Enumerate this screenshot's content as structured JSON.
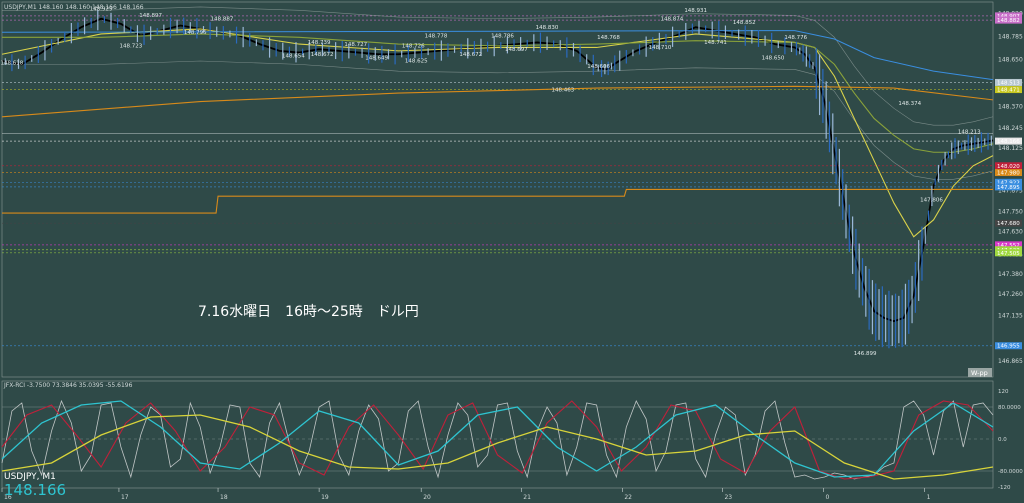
{
  "header": {
    "symbol_info": "USDJPY,M1  148.160 148.160 148.166 148.166",
    "osc_info": "JFX-RCI -3.7500 73.3846 35.0395 -55.6196",
    "annotation": "7.16水曜日　16時～25時　ドル円",
    "symbol_label": "USDJPY, M1",
    "current_price": "148.166",
    "pivot_tag": "W-pp"
  },
  "colors": {
    "background": "#2f4a48",
    "price_line": "#000000",
    "ma_fast": "#d9d24a",
    "ma_mid": "#8aa23a",
    "ma_slow": "#d88a1a",
    "band": "#9aa6a4",
    "resistance_blue": "#3a8ee0",
    "rci_short": "#c0c6c6",
    "rci_mid": "#c0203a",
    "rci_long_cyan": "#2ec4d0",
    "rci_long_yellow": "#d8d43a"
  },
  "chart_data": [
    {
      "type": "line",
      "name": "main",
      "ylim": [
        146.77,
        148.93
      ],
      "xlim": [
        0,
        1000
      ],
      "x_ticks": [
        {
          "x": 0,
          "label": "16"
        },
        {
          "x": 118,
          "label": "17"
        },
        {
          "x": 218,
          "label": "18"
        },
        {
          "x": 320,
          "label": "19"
        },
        {
          "x": 423,
          "label": "20"
        },
        {
          "x": 524,
          "label": "21"
        },
        {
          "x": 626,
          "label": "22"
        },
        {
          "x": 727,
          "label": "23"
        },
        {
          "x": 829,
          "label": "0"
        },
        {
          "x": 931,
          "label": "1"
        }
      ],
      "y_ticks": [
        "148.920",
        "148.785",
        "148.650",
        "148.515",
        "148.370",
        "148.245",
        "148.125",
        "147.875",
        "147.750",
        "147.630",
        "147.495",
        "147.380",
        "147.260",
        "147.135",
        "146.865"
      ],
      "price_tags": [
        {
          "value": 148.907,
          "label": "148.907",
          "color": "#c86ec8"
        },
        {
          "value": 148.882,
          "label": "148.882",
          "color": "#c86ec8"
        },
        {
          "value": 148.513,
          "label": "148.513",
          "color": "#b8c8d0"
        },
        {
          "value": 148.471,
          "label": "148.471",
          "color": "#c8c820"
        },
        {
          "value": 148.166,
          "label": "148.166",
          "color": "#e8e8e8"
        },
        {
          "value": 148.02,
          "label": "148.020",
          "color": "#c0203a"
        },
        {
          "value": 147.98,
          "label": "147.980",
          "color": "#d88a1a"
        },
        {
          "value": 147.922,
          "label": "147.922",
          "color": "#3a8ee0"
        },
        {
          "value": 147.895,
          "label": "147.895",
          "color": "#3a8ee0"
        },
        {
          "value": 147.68,
          "label": "147.680",
          "color": "#444444"
        },
        {
          "value": 147.552,
          "label": "147.552",
          "color": "#d838c8"
        },
        {
          "value": 147.523,
          "label": "147.523",
          "color": "#a0d840"
        },
        {
          "value": 147.505,
          "label": "147.505",
          "color": "#a0d840"
        },
        {
          "value": 146.955,
          "label": "146.955",
          "color": "#3a8ee0"
        }
      ],
      "price_labels": [
        {
          "x": 10,
          "v": 148.62,
          "text": "148.618"
        },
        {
          "x": 100,
          "v": 148.94,
          "text": "148.929"
        },
        {
          "x": 130,
          "v": 148.72,
          "text": "148.723"
        },
        {
          "x": 150,
          "v": 148.9,
          "text": "148.897"
        },
        {
          "x": 195,
          "v": 148.8,
          "text": "148.795"
        },
        {
          "x": 222,
          "v": 148.88,
          "text": "148.887"
        },
        {
          "x": 294,
          "v": 148.66,
          "text": "148.654"
        },
        {
          "x": 320,
          "v": 148.74,
          "text": "148.739"
        },
        {
          "x": 323,
          "v": 148.67,
          "text": "148.672"
        },
        {
          "x": 357,
          "v": 148.73,
          "text": "148.727"
        },
        {
          "x": 378,
          "v": 148.65,
          "text": "148.649"
        },
        {
          "x": 415,
          "v": 148.72,
          "text": "148.726"
        },
        {
          "x": 418,
          "v": 148.63,
          "text": "148.625"
        },
        {
          "x": 438,
          "v": 148.78,
          "text": "148.778"
        },
        {
          "x": 473,
          "v": 148.67,
          "text": "148.672"
        },
        {
          "x": 505,
          "v": 148.78,
          "text": "148.786"
        },
        {
          "x": 519,
          "v": 148.7,
          "text": "148.697"
        },
        {
          "x": 550,
          "v": 148.83,
          "text": "148.830"
        },
        {
          "x": 566,
          "v": 148.46,
          "text": "148.463"
        },
        {
          "x": 612,
          "v": 148.77,
          "text": "148.768"
        },
        {
          "x": 602,
          "v": 148.6,
          "text": "148.606"
        },
        {
          "x": 664,
          "v": 148.71,
          "text": "148.710"
        },
        {
          "x": 676,
          "v": 148.88,
          "text": "148.874"
        },
        {
          "x": 700,
          "v": 148.93,
          "text": "148.931"
        },
        {
          "x": 720,
          "v": 148.74,
          "text": "148.741"
        },
        {
          "x": 749,
          "v": 148.86,
          "text": "148.852"
        },
        {
          "x": 778,
          "v": 148.65,
          "text": "148.650"
        },
        {
          "x": 801,
          "v": 148.77,
          "text": "148.776"
        },
        {
          "x": 916,
          "v": 148.38,
          "text": "148.374"
        },
        {
          "x": 976,
          "v": 148.21,
          "text": "148.213"
        },
        {
          "x": 938,
          "v": 147.81,
          "text": "147.806"
        },
        {
          "x": 871,
          "v": 146.9,
          "text": "146.899"
        }
      ],
      "series": [
        {
          "role": "price",
          "x": [
            0,
            20,
            40,
            60,
            80,
            100,
            120,
            140,
            160,
            180,
            200,
            220,
            240,
            260,
            280,
            300,
            320,
            340,
            360,
            380,
            400,
            420,
            440,
            460,
            480,
            500,
            520,
            540,
            560,
            580,
            600,
            610,
            620,
            640,
            660,
            680,
            700,
            720,
            740,
            760,
            780,
            800,
            810,
            820,
            830,
            840,
            850,
            860,
            870,
            880,
            890,
            900,
            910,
            920,
            930,
            940,
            950,
            960,
            970,
            980,
            990,
            1000
          ],
          "values": [
            148.64,
            148.62,
            148.69,
            148.77,
            148.84,
            148.89,
            148.86,
            148.79,
            148.82,
            148.85,
            148.83,
            148.81,
            148.79,
            148.74,
            148.7,
            148.69,
            148.71,
            148.7,
            148.69,
            148.68,
            148.68,
            148.69,
            148.7,
            148.71,
            148.72,
            148.73,
            148.74,
            148.75,
            148.74,
            148.7,
            148.6,
            148.59,
            148.63,
            148.7,
            148.75,
            148.79,
            148.84,
            148.82,
            148.8,
            148.78,
            148.74,
            148.72,
            148.68,
            148.6,
            148.4,
            148.1,
            147.8,
            147.5,
            147.3,
            147.16,
            147.12,
            147.1,
            147.12,
            147.25,
            147.55,
            147.9,
            148.05,
            148.12,
            148.14,
            148.15,
            148.16,
            148.17
          ]
        },
        {
          "role": "ma_fast",
          "x": [
            0,
            100,
            200,
            300,
            400,
            500,
            600,
            700,
            800,
            820,
            840,
            860,
            880,
            900,
            920,
            940,
            960,
            980,
            1000
          ],
          "values": [
            148.68,
            148.8,
            148.83,
            148.74,
            148.7,
            148.72,
            148.72,
            148.8,
            148.75,
            148.72,
            148.55,
            148.3,
            148.05,
            147.8,
            147.6,
            147.7,
            147.9,
            148.02,
            148.08
          ]
        },
        {
          "role": "ma_mid",
          "x": [
            0,
            100,
            200,
            300,
            400,
            500,
            600,
            700,
            800,
            820,
            840,
            860,
            880,
            900,
            920,
            940,
            960,
            980,
            1000
          ],
          "values": [
            148.78,
            148.78,
            148.8,
            148.78,
            148.74,
            148.73,
            148.74,
            148.76,
            148.75,
            148.72,
            148.62,
            148.45,
            148.3,
            148.2,
            148.12,
            148.1,
            148.1,
            148.12,
            148.15
          ]
        },
        {
          "role": "ma_slow_stepped",
          "x": [
            0,
            216,
            218,
            628,
            630,
            1000
          ],
          "values": [
            147.74,
            147.74,
            147.84,
            147.84,
            147.88,
            147.88
          ]
        },
        {
          "role": "ma_slow_curve",
          "x": [
            0,
            200,
            400,
            600,
            800,
            900,
            1000
          ],
          "values": [
            148.31,
            148.4,
            148.45,
            148.48,
            148.49,
            148.48,
            148.41
          ]
        },
        {
          "role": "resistance",
          "x": [
            0,
            800,
            840,
            880,
            940,
            1000
          ],
          "values": [
            148.81,
            148.82,
            148.77,
            148.66,
            148.58,
            148.53
          ]
        }
      ]
    },
    {
      "type": "line",
      "name": "rci",
      "ylim": [
        -120,
        120
      ],
      "y_ticks": [
        "120",
        "80.0000",
        "0.0",
        "-80.0000",
        "-120"
      ],
      "series": [
        {
          "role": "rci_short",
          "x": [
            0,
            10,
            20,
            30,
            40,
            50,
            60,
            70,
            80,
            90,
            100,
            110,
            120,
            130,
            140,
            150,
            160,
            170,
            180,
            190,
            200,
            210,
            220,
            230,
            240,
            250,
            260,
            270,
            280,
            290,
            300,
            310,
            320,
            330,
            340,
            350,
            360,
            370,
            380,
            390,
            400,
            410,
            420,
            430,
            440,
            450,
            460,
            470,
            480,
            490,
            500,
            510,
            520,
            530,
            540,
            550,
            560,
            570,
            580,
            590,
            600,
            610,
            620,
            630,
            640,
            650,
            660,
            670,
            680,
            690,
            700,
            710,
            720,
            730,
            740,
            750,
            760,
            770,
            780,
            790,
            800,
            810,
            820,
            830,
            840,
            850,
            860,
            870,
            880,
            890,
            900,
            910,
            920,
            930,
            940,
            950,
            960,
            970,
            980,
            990,
            1000
          ],
          "values": [
            -60,
            70,
            90,
            -30,
            -90,
            20,
            95,
            40,
            -80,
            -40,
            85,
            90,
            -20,
            -95,
            10,
            80,
            60,
            -70,
            -50,
            90,
            30,
            -85,
            -20,
            85,
            80,
            -60,
            -95,
            40,
            90,
            -10,
            -90,
            -30,
            80,
            95,
            -40,
            -90,
            20,
            85,
            50,
            -80,
            -60,
            70,
            95,
            -20,
            -95,
            10,
            90,
            60,
            -70,
            -40,
            85,
            90,
            -30,
            -95,
            20,
            80,
            40,
            -90,
            -20,
            90,
            85,
            -40,
            -95,
            30,
            95,
            50,
            -80,
            -30,
            85,
            90,
            -50,
            -95,
            10,
            80,
            60,
            -90,
            -40,
            70,
            95,
            -10,
            -95,
            -90,
            -100,
            -95,
            -85,
            -90,
            -100,
            -95,
            -90,
            -70,
            -60,
            80,
            95,
            60,
            -40,
            70,
            95,
            -20,
            85,
            90,
            60
          ]
        },
        {
          "role": "rci_mid",
          "x": [
            0,
            25,
            50,
            75,
            100,
            125,
            150,
            175,
            200,
            225,
            250,
            275,
            300,
            325,
            350,
            375,
            400,
            425,
            450,
            475,
            500,
            525,
            550,
            575,
            600,
            625,
            650,
            675,
            700,
            725,
            750,
            775,
            800,
            825,
            850,
            875,
            900,
            925,
            950,
            975,
            1000
          ],
          "values": [
            -20,
            60,
            85,
            10,
            -70,
            40,
            90,
            20,
            -80,
            -20,
            80,
            60,
            -60,
            -90,
            30,
            85,
            10,
            -75,
            60,
            90,
            -40,
            -85,
            40,
            95,
            30,
            -80,
            -20,
            85,
            70,
            -50,
            -85,
            20,
            80,
            -80,
            -100,
            -95,
            -80,
            60,
            95,
            85,
            20
          ]
        },
        {
          "role": "rci_long_cyan",
          "x": [
            0,
            40,
            80,
            120,
            160,
            200,
            240,
            280,
            320,
            360,
            400,
            440,
            480,
            520,
            560,
            600,
            640,
            680,
            720,
            760,
            800,
            840,
            880,
            920,
            960,
            1000
          ],
          "values": [
            -50,
            40,
            85,
            95,
            30,
            -60,
            -75,
            -10,
            70,
            40,
            -65,
            -30,
            60,
            80,
            -20,
            -80,
            -20,
            60,
            85,
            10,
            -60,
            -95,
            -90,
            20,
            90,
            30
          ]
        },
        {
          "role": "rci_long_yellow",
          "x": [
            0,
            50,
            100,
            150,
            200,
            250,
            300,
            350,
            400,
            450,
            500,
            550,
            600,
            650,
            700,
            750,
            800,
            850,
            900,
            950,
            1000
          ],
          "values": [
            -80,
            -60,
            10,
            55,
            60,
            30,
            -30,
            -70,
            -75,
            -60,
            -10,
            30,
            0,
            -40,
            -30,
            10,
            20,
            -60,
            -100,
            -90,
            -70
          ]
        }
      ]
    }
  ]
}
